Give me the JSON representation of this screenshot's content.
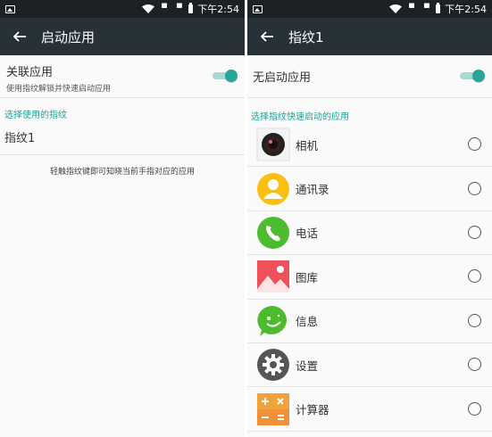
{
  "status_bar": {
    "time": "下午2:54"
  },
  "left_screen": {
    "title": "启动应用",
    "toggle_row": {
      "title": "关联应用",
      "subtitle": "使用指纹解锁并快速启动应用",
      "on": true
    },
    "section_header": "选择使用的指纹",
    "fingerprint_item": "指纹1",
    "hint": "轻触指纹键即可知晓当前手指对应的应用"
  },
  "right_screen": {
    "title": "指纹1",
    "toggle_row": {
      "title": "无启动应用",
      "on": true
    },
    "section_header": "选择指纹快速启动的应用",
    "apps": [
      {
        "label": "相机",
        "icon": "camera-icon"
      },
      {
        "label": "通讯录",
        "icon": "contacts-icon"
      },
      {
        "label": "电话",
        "icon": "phone-icon"
      },
      {
        "label": "图库",
        "icon": "gallery-icon"
      },
      {
        "label": "信息",
        "icon": "messages-icon"
      },
      {
        "label": "设置",
        "icon": "settings-icon"
      },
      {
        "label": "计算器",
        "icon": "calculator-icon"
      }
    ]
  },
  "colors": {
    "appbar": "#263238",
    "statusbar": "#1c2124",
    "accent": "#17a39a",
    "toggle_thumb": "#26a69a"
  }
}
